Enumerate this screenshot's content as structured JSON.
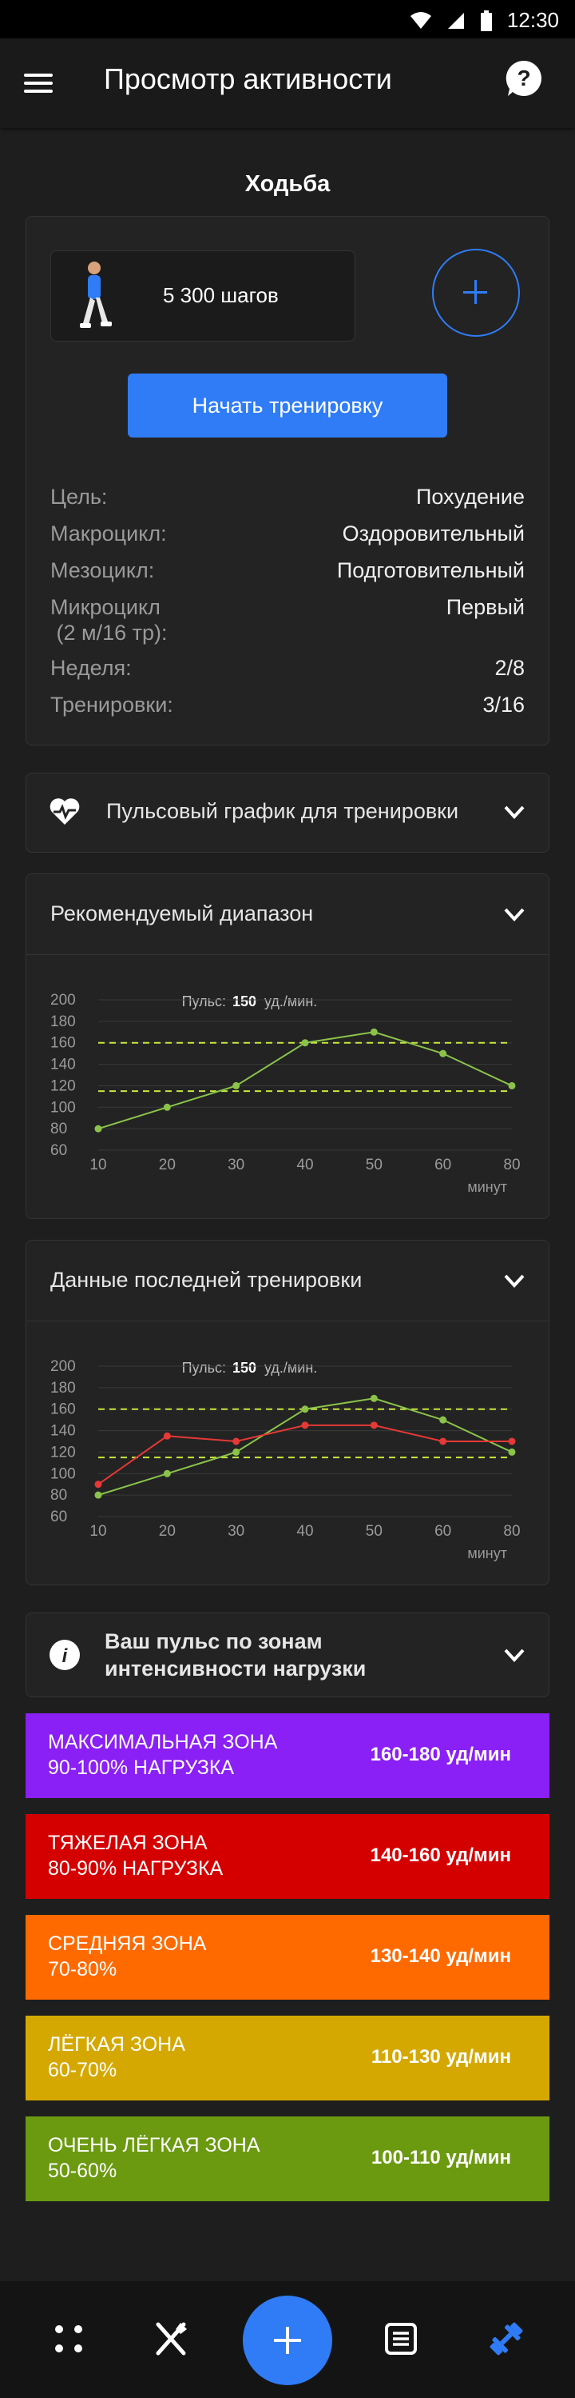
{
  "status": {
    "time": "12:30"
  },
  "header": {
    "title": "Просмотр активности"
  },
  "activity": {
    "title": "Ходьба",
    "steps": "5 300 шагов",
    "start_label": "Начать тренировку",
    "rows": [
      {
        "key": "Цель:",
        "value": "Похудение"
      },
      {
        "key": "Макроцикл:",
        "value": "Оздоровительный"
      },
      {
        "key": "Мезоцикл:",
        "value": "Подготовительный"
      },
      {
        "key": "Микроцикл\n (2 м/16 тр):",
        "value": "Первый"
      },
      {
        "key": "Неделя:",
        "value": "2/8"
      },
      {
        "key": "Тренировки:",
        "value": "3/16"
      }
    ]
  },
  "pulse_section": {
    "label": "Пульсовый график для тренировки"
  },
  "recommended": {
    "label": "Рекомендуемый диапазон",
    "pulse_label": "Пульс:",
    "pulse_value": "150",
    "pulse_unit": "уд./мин.",
    "x_unit": "минут"
  },
  "last": {
    "label": "Данные последней тренировки",
    "pulse_label": "Пульс:",
    "pulse_value": "150",
    "pulse_unit": "уд./мин.",
    "x_unit": "минут"
  },
  "chart_data": [
    {
      "type": "line",
      "x": [
        10,
        20,
        30,
        40,
        50,
        60,
        80
      ],
      "xticks": [
        10,
        20,
        30,
        40,
        50,
        60,
        80
      ],
      "yticks": [
        60,
        80,
        100,
        120,
        140,
        160,
        180,
        200
      ],
      "ylim": [
        60,
        200
      ],
      "series": [
        {
          "values": [
            80,
            100,
            120,
            160,
            170,
            150,
            120
          ],
          "color": "#8bc34a"
        }
      ],
      "thresholds": [
        160,
        115
      ],
      "threshold_color": "#c6e83a"
    },
    {
      "type": "line",
      "x": [
        10,
        20,
        30,
        40,
        50,
        60,
        80
      ],
      "xticks": [
        10,
        20,
        30,
        40,
        50,
        60,
        80
      ],
      "yticks": [
        60,
        80,
        100,
        120,
        140,
        160,
        180,
        200
      ],
      "ylim": [
        60,
        200
      ],
      "series": [
        {
          "values": [
            80,
            100,
            120,
            160,
            170,
            150,
            120
          ],
          "color": "#8bc34a"
        },
        {
          "values": [
            90,
            135,
            130,
            145,
            145,
            130,
            130
          ],
          "color": "#e53935"
        }
      ],
      "thresholds": [
        160,
        115
      ],
      "threshold_color": "#c6e83a"
    }
  ],
  "zones_section": {
    "label": "Ваш пульс по зонам\nинтенсивности нагрузки"
  },
  "zones": [
    {
      "name": "Максимальная зона",
      "load": "90-100% нагрузка",
      "range": "160-180 уд/мин",
      "color": "#8a1ff6"
    },
    {
      "name": "Тяжелая зона",
      "load": "80-90% нагрузка",
      "range": "140-160 уд/мин",
      "color": "#d40000"
    },
    {
      "name": "Средняя зона",
      "load": "70-80%",
      "range": "130-140 уд/мин",
      "color": "#ff6a00"
    },
    {
      "name": "Лёгкая зона",
      "load": "60-70%",
      "range": "110-130 уд/мин",
      "color": "#d4a800"
    },
    {
      "name": "Очень лёгкая зона",
      "load": "50-60%",
      "range": "100-110 уд/мин",
      "color": "#6b9a10"
    }
  ]
}
